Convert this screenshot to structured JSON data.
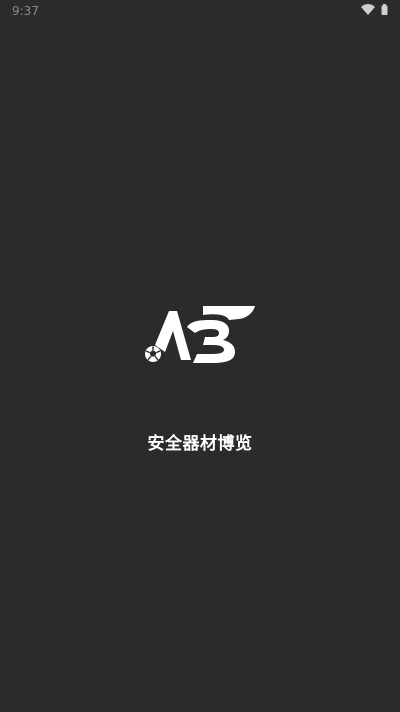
{
  "status_bar": {
    "time": "9:37",
    "icons": [
      "wifi-icon",
      "battery-icon"
    ]
  },
  "splash": {
    "logo_icon": "ab-soccer-logo-icon",
    "app_name": "安全器材博览"
  },
  "colors": {
    "background": "#2b2b2b",
    "logo": "#ffffff",
    "text": "#ffffff",
    "status_text": "#8a8a8a"
  }
}
